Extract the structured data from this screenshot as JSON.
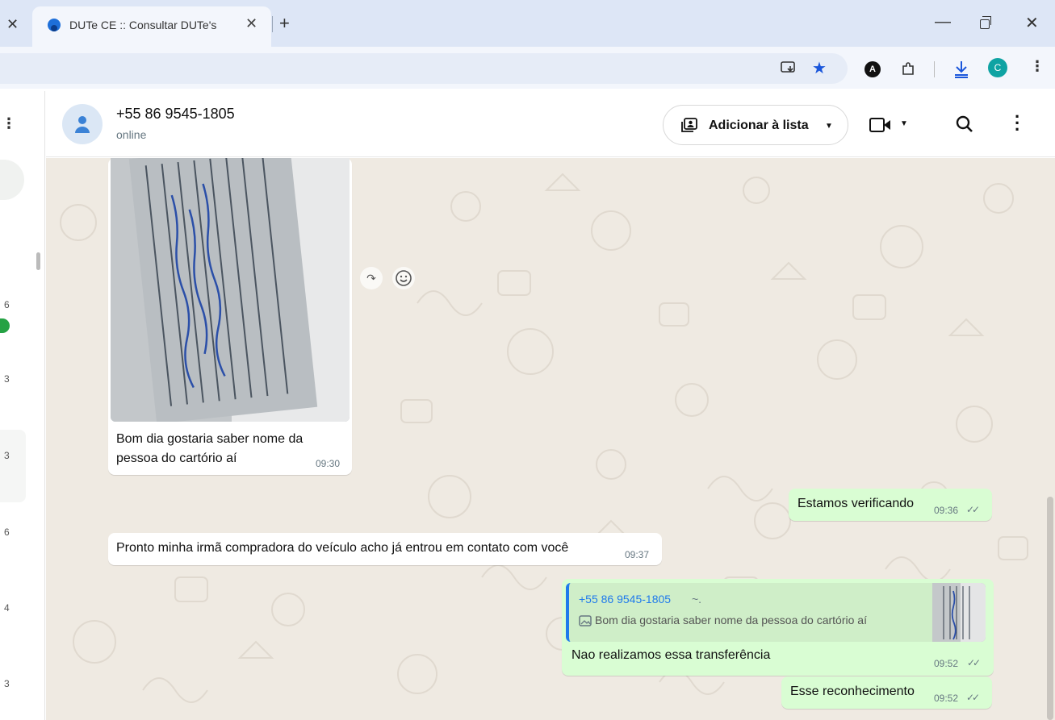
{
  "browser": {
    "tab_title": "DUTe CE :: Consultar DUTe's",
    "profile_initial": "C",
    "extension_initial": "A",
    "icons": [
      "close-icon",
      "plus-icon",
      "minimize-icon",
      "restore-icon",
      "cast-icon",
      "star-icon",
      "extensions-icon",
      "download-icon",
      "more-vert-icon"
    ],
    "accent": "#1a56db"
  },
  "chat_list_peek": {
    "numbers": [
      "6",
      "3",
      "3",
      "6",
      "4",
      "3"
    ]
  },
  "header": {
    "contact_name": "+55 86 9545-1805",
    "status": "online",
    "add_to_list_label": "Adicionar à lista"
  },
  "messages": {
    "m1": {
      "direction": "incoming",
      "type": "image",
      "caption_line1": "Bom dia gostaria saber nome da",
      "caption_line2": "pessoa do cartório aí",
      "time": "09:30"
    },
    "m2": {
      "direction": "outgoing",
      "text": "Estamos verificando",
      "time": "09:36"
    },
    "m3": {
      "direction": "incoming",
      "text": "Pronto minha irmã compradora do veículo acho já entrou em contato com você",
      "time": "09:37"
    },
    "m4": {
      "direction": "outgoing",
      "quote": {
        "author": "+55 86 9545-1805",
        "suffix": "~.",
        "text": "Bom dia gostaria saber nome da pessoa do cartório aí"
      },
      "text": "Nao realizamos essa transferência",
      "time": "09:52"
    },
    "m5": {
      "direction": "outgoing",
      "text": "Esse reconhecimento",
      "time": "09:52"
    }
  },
  "colors": {
    "incoming_bubble": "#ffffff",
    "outgoing_bubble": "#d9fdd3",
    "chat_background": "#efeae2",
    "quote_bar": "#1f7aec"
  }
}
